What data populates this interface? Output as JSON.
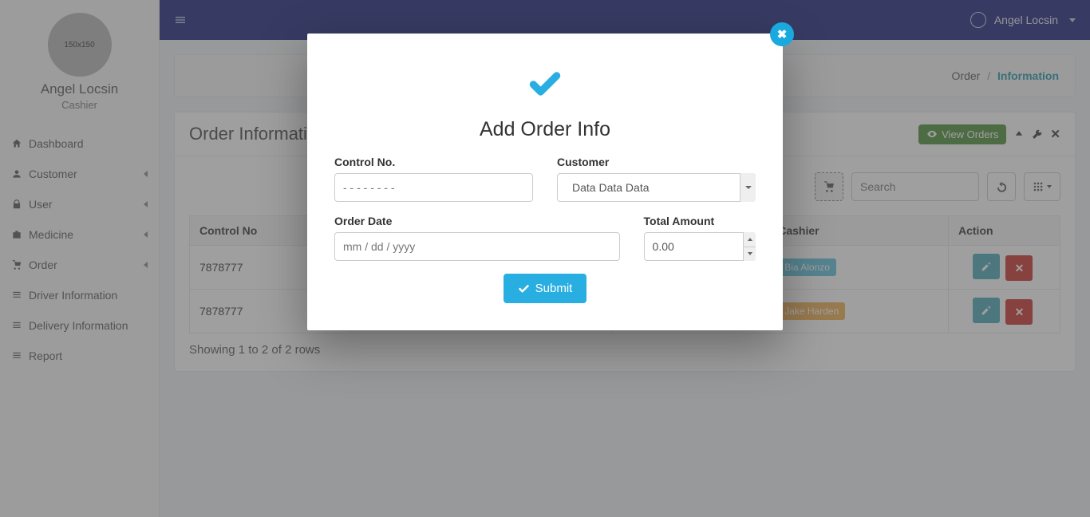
{
  "sidebar": {
    "avatar_text": "150x150",
    "name": "Angel Locsin",
    "role": "Cashier",
    "items": [
      {
        "label": "Dashboard",
        "icon": "home",
        "expandable": false
      },
      {
        "label": "Customer",
        "icon": "user",
        "expandable": true
      },
      {
        "label": "User",
        "icon": "lock",
        "expandable": true
      },
      {
        "label": "Medicine",
        "icon": "medkit",
        "expandable": true
      },
      {
        "label": "Order",
        "icon": "cart",
        "expandable": true
      },
      {
        "label": "Driver Information",
        "icon": "list",
        "expandable": false
      },
      {
        "label": "Delivery Information",
        "icon": "list",
        "expandable": false
      },
      {
        "label": "Report",
        "icon": "list",
        "expandable": false
      }
    ]
  },
  "topbar": {
    "user": "Angel Locsin"
  },
  "breadcrumb": {
    "parent": "Order",
    "sep": "/",
    "active": "Information"
  },
  "panel": {
    "title": "Order Information",
    "view_orders": "View Orders",
    "search_placeholder": "Search",
    "columns": {
      "c0": "Control No",
      "c3": "Cashier",
      "c4": "Action"
    },
    "rows": [
      {
        "control": "7878777",
        "cashier": "Bia Alonzo",
        "cashier_style": "info"
      },
      {
        "control": "7878777",
        "cashier": "Jake Harden",
        "cashier_style": "warning"
      }
    ],
    "summary": "Showing 1 to 2 of 2 rows"
  },
  "modal": {
    "title": "Add Order Info",
    "labels": {
      "control": "Control No.",
      "customer": "Customer",
      "order_date": "Order Date",
      "total": "Total Amount"
    },
    "placeholders": {
      "control": "- - - - - - - -",
      "order_date": "mm / dd / yyyy"
    },
    "customer_value": "Data Data Data",
    "total_value": "0.00",
    "submit": "Submit"
  }
}
